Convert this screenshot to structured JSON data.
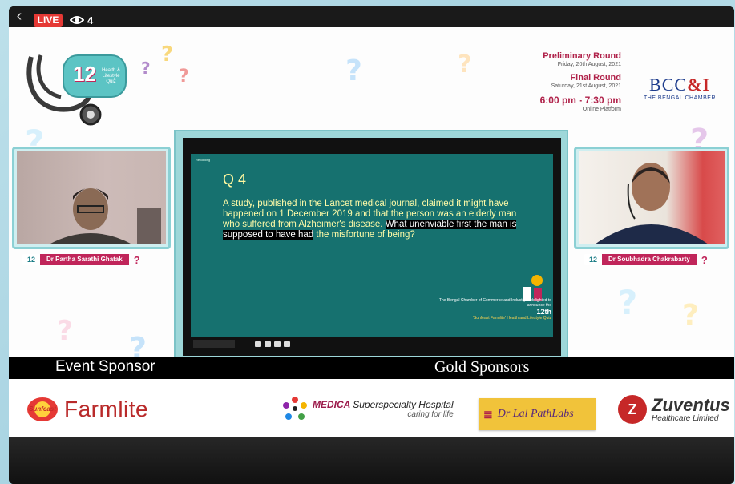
{
  "topbar": {
    "back_glyph": "‹",
    "live_label": "LIVE",
    "viewer_count": "4"
  },
  "logo": {
    "number": "12",
    "line1": "Health &",
    "line2": "Lifestyle",
    "line3": "Quiz"
  },
  "schedule": {
    "prelim_title": "Preliminary Round",
    "prelim_date": "Friday, 20th August, 2021",
    "final_title": "Final Round",
    "final_date": "Saturday, 21st August, 2021",
    "time": "6:00 pm - 7:30 pm",
    "platform": "Online Platform"
  },
  "bcc": {
    "logo_text": "BCC",
    "logo_amp": "&I",
    "name": "THE BENGAL CHAMBER"
  },
  "participants": [
    {
      "badge": "12",
      "name": "Dr Partha Sarathi Ghatak",
      "mark": "?"
    },
    {
      "badge": "12",
      "name": "Dr Soubhadra Chakrabarty",
      "mark": "?"
    }
  ],
  "slide": {
    "recording_label": "Recording",
    "question_number": "Q 4",
    "question_plain": "A study, published in the Lancet medical journal, claimed it might have happened  on 1 December 2019  and that the person  was an elderly man who suffered from Alzheimer's disease.",
    "question_highlight": "What unenviable first the man is supposed to have had",
    "question_end": "the misfortune of being?",
    "footer_line1": "The Bengal Chamber of Commerce and Industry is delighted to announce the",
    "footer_line2": "12th",
    "footer_line3": "'Sunfeast Farmlite' Health and Lifestyle Quiz"
  },
  "sponsors": {
    "event_label": "Event Sponsor",
    "gold_label": "Gold Sponsors",
    "sunfeast": "Sunfeast",
    "farmlite": "Farmlite",
    "medica_brand": "MEDICA",
    "medica_rest": "Superspecialty Hospital",
    "medica_tag": "caring for life",
    "drlal": "Dr Lal PathLabs",
    "zuventus": "Zuventus",
    "zuventus_sub": "Healthcare Limited"
  },
  "colors": {
    "live": "#e53935",
    "slide_bg": "#16716f",
    "accent": "#b0224a"
  }
}
